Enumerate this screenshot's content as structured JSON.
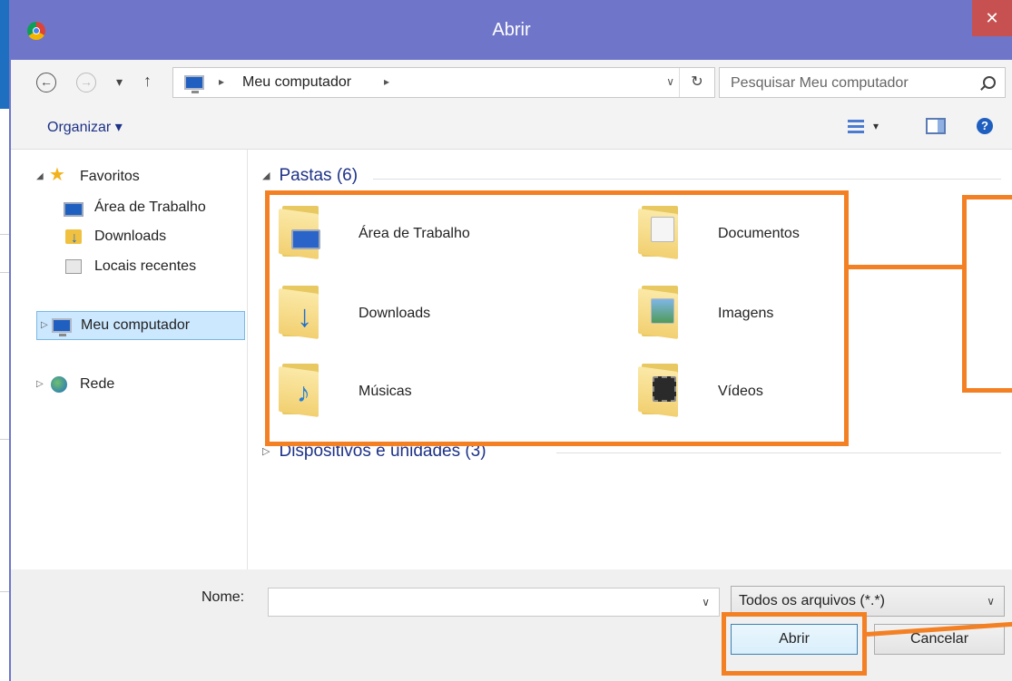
{
  "window": {
    "title": "Abrir",
    "close_label": "✕"
  },
  "address": {
    "back_glyph": "←",
    "forward_glyph": "→",
    "recent_glyph": "▾",
    "up_glyph": "↑",
    "crumb": "Meu computador",
    "crumb_sep": "▸",
    "dropdown_glyph": "∨",
    "refresh_glyph": "↻"
  },
  "search": {
    "placeholder": "Pesquisar Meu computador"
  },
  "toolbar": {
    "organize_label": "Organizar ▾",
    "view_drop_glyph": "▾",
    "help_glyph": "?"
  },
  "navpane": {
    "favorites_label": "Favoritos",
    "favorites_items": [
      {
        "label": "Área de Trabalho",
        "icon": "desktop-icon"
      },
      {
        "label": "Downloads",
        "icon": "downloads-icon"
      },
      {
        "label": "Locais recentes",
        "icon": "recent-places-icon"
      }
    ],
    "computer_label": "Meu computador",
    "network_label": "Rede",
    "expanded_glyph": "◢",
    "collapsed_glyph": "▷"
  },
  "content": {
    "folders_header": "Pastas (6)",
    "folders": [
      {
        "label": "Área de Trabalho",
        "icon": "desktop-folder-icon"
      },
      {
        "label": "Documentos",
        "icon": "documents-folder-icon"
      },
      {
        "label": "Downloads",
        "icon": "downloads-folder-icon"
      },
      {
        "label": "Imagens",
        "icon": "pictures-folder-icon"
      },
      {
        "label": "Músicas",
        "icon": "music-folder-icon"
      },
      {
        "label": "Vídeos",
        "icon": "videos-folder-icon"
      }
    ],
    "devices_header": "Dispositivos e unidades (3)",
    "header_expanded_glyph": "◢",
    "header_collapsed_glyph": "▷"
  },
  "bottom": {
    "name_label": "Nome:",
    "name_value": "",
    "name_dropdown_glyph": "∨",
    "filter_value": "Todos os arquivos (*.*)",
    "filter_dropdown_glyph": "∨",
    "open_label": "Abrir",
    "cancel_label": "Cancelar"
  },
  "colors": {
    "titlebar": "#6f76c9",
    "close": "#c75050",
    "link_blue": "#1e3287",
    "annotation_orange": "#f48024",
    "selection": "#cce8ff"
  }
}
